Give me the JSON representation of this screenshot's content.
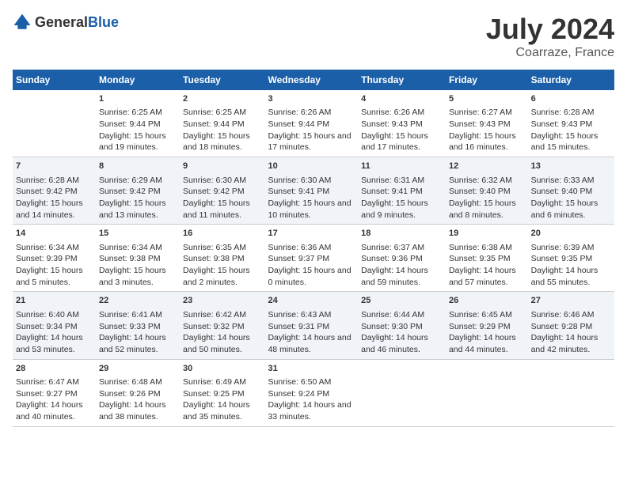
{
  "header": {
    "logo_general": "General",
    "logo_blue": "Blue",
    "title": "July 2024",
    "subtitle": "Coarraze, France"
  },
  "days_of_week": [
    "Sunday",
    "Monday",
    "Tuesday",
    "Wednesday",
    "Thursday",
    "Friday",
    "Saturday"
  ],
  "weeks": [
    [
      {
        "day": "",
        "sunrise": "",
        "sunset": "",
        "daylight": ""
      },
      {
        "day": "1",
        "sunrise": "Sunrise: 6:25 AM",
        "sunset": "Sunset: 9:44 PM",
        "daylight": "Daylight: 15 hours and 19 minutes."
      },
      {
        "day": "2",
        "sunrise": "Sunrise: 6:25 AM",
        "sunset": "Sunset: 9:44 PM",
        "daylight": "Daylight: 15 hours and 18 minutes."
      },
      {
        "day": "3",
        "sunrise": "Sunrise: 6:26 AM",
        "sunset": "Sunset: 9:44 PM",
        "daylight": "Daylight: 15 hours and 17 minutes."
      },
      {
        "day": "4",
        "sunrise": "Sunrise: 6:26 AM",
        "sunset": "Sunset: 9:43 PM",
        "daylight": "Daylight: 15 hours and 17 minutes."
      },
      {
        "day": "5",
        "sunrise": "Sunrise: 6:27 AM",
        "sunset": "Sunset: 9:43 PM",
        "daylight": "Daylight: 15 hours and 16 minutes."
      },
      {
        "day": "6",
        "sunrise": "Sunrise: 6:28 AM",
        "sunset": "Sunset: 9:43 PM",
        "daylight": "Daylight: 15 hours and 15 minutes."
      }
    ],
    [
      {
        "day": "7",
        "sunrise": "Sunrise: 6:28 AM",
        "sunset": "Sunset: 9:42 PM",
        "daylight": "Daylight: 15 hours and 14 minutes."
      },
      {
        "day": "8",
        "sunrise": "Sunrise: 6:29 AM",
        "sunset": "Sunset: 9:42 PM",
        "daylight": "Daylight: 15 hours and 13 minutes."
      },
      {
        "day": "9",
        "sunrise": "Sunrise: 6:30 AM",
        "sunset": "Sunset: 9:42 PM",
        "daylight": "Daylight: 15 hours and 11 minutes."
      },
      {
        "day": "10",
        "sunrise": "Sunrise: 6:30 AM",
        "sunset": "Sunset: 9:41 PM",
        "daylight": "Daylight: 15 hours and 10 minutes."
      },
      {
        "day": "11",
        "sunrise": "Sunrise: 6:31 AM",
        "sunset": "Sunset: 9:41 PM",
        "daylight": "Daylight: 15 hours and 9 minutes."
      },
      {
        "day": "12",
        "sunrise": "Sunrise: 6:32 AM",
        "sunset": "Sunset: 9:40 PM",
        "daylight": "Daylight: 15 hours and 8 minutes."
      },
      {
        "day": "13",
        "sunrise": "Sunrise: 6:33 AM",
        "sunset": "Sunset: 9:40 PM",
        "daylight": "Daylight: 15 hours and 6 minutes."
      }
    ],
    [
      {
        "day": "14",
        "sunrise": "Sunrise: 6:34 AM",
        "sunset": "Sunset: 9:39 PM",
        "daylight": "Daylight: 15 hours and 5 minutes."
      },
      {
        "day": "15",
        "sunrise": "Sunrise: 6:34 AM",
        "sunset": "Sunset: 9:38 PM",
        "daylight": "Daylight: 15 hours and 3 minutes."
      },
      {
        "day": "16",
        "sunrise": "Sunrise: 6:35 AM",
        "sunset": "Sunset: 9:38 PM",
        "daylight": "Daylight: 15 hours and 2 minutes."
      },
      {
        "day": "17",
        "sunrise": "Sunrise: 6:36 AM",
        "sunset": "Sunset: 9:37 PM",
        "daylight": "Daylight: 15 hours and 0 minutes."
      },
      {
        "day": "18",
        "sunrise": "Sunrise: 6:37 AM",
        "sunset": "Sunset: 9:36 PM",
        "daylight": "Daylight: 14 hours and 59 minutes."
      },
      {
        "day": "19",
        "sunrise": "Sunrise: 6:38 AM",
        "sunset": "Sunset: 9:35 PM",
        "daylight": "Daylight: 14 hours and 57 minutes."
      },
      {
        "day": "20",
        "sunrise": "Sunrise: 6:39 AM",
        "sunset": "Sunset: 9:35 PM",
        "daylight": "Daylight: 14 hours and 55 minutes."
      }
    ],
    [
      {
        "day": "21",
        "sunrise": "Sunrise: 6:40 AM",
        "sunset": "Sunset: 9:34 PM",
        "daylight": "Daylight: 14 hours and 53 minutes."
      },
      {
        "day": "22",
        "sunrise": "Sunrise: 6:41 AM",
        "sunset": "Sunset: 9:33 PM",
        "daylight": "Daylight: 14 hours and 52 minutes."
      },
      {
        "day": "23",
        "sunrise": "Sunrise: 6:42 AM",
        "sunset": "Sunset: 9:32 PM",
        "daylight": "Daylight: 14 hours and 50 minutes."
      },
      {
        "day": "24",
        "sunrise": "Sunrise: 6:43 AM",
        "sunset": "Sunset: 9:31 PM",
        "daylight": "Daylight: 14 hours and 48 minutes."
      },
      {
        "day": "25",
        "sunrise": "Sunrise: 6:44 AM",
        "sunset": "Sunset: 9:30 PM",
        "daylight": "Daylight: 14 hours and 46 minutes."
      },
      {
        "day": "26",
        "sunrise": "Sunrise: 6:45 AM",
        "sunset": "Sunset: 9:29 PM",
        "daylight": "Daylight: 14 hours and 44 minutes."
      },
      {
        "day": "27",
        "sunrise": "Sunrise: 6:46 AM",
        "sunset": "Sunset: 9:28 PM",
        "daylight": "Daylight: 14 hours and 42 minutes."
      }
    ],
    [
      {
        "day": "28",
        "sunrise": "Sunrise: 6:47 AM",
        "sunset": "Sunset: 9:27 PM",
        "daylight": "Daylight: 14 hours and 40 minutes."
      },
      {
        "day": "29",
        "sunrise": "Sunrise: 6:48 AM",
        "sunset": "Sunset: 9:26 PM",
        "daylight": "Daylight: 14 hours and 38 minutes."
      },
      {
        "day": "30",
        "sunrise": "Sunrise: 6:49 AM",
        "sunset": "Sunset: 9:25 PM",
        "daylight": "Daylight: 14 hours and 35 minutes."
      },
      {
        "day": "31",
        "sunrise": "Sunrise: 6:50 AM",
        "sunset": "Sunset: 9:24 PM",
        "daylight": "Daylight: 14 hours and 33 minutes."
      },
      {
        "day": "",
        "sunrise": "",
        "sunset": "",
        "daylight": ""
      },
      {
        "day": "",
        "sunrise": "",
        "sunset": "",
        "daylight": ""
      },
      {
        "day": "",
        "sunrise": "",
        "sunset": "",
        "daylight": ""
      }
    ]
  ]
}
